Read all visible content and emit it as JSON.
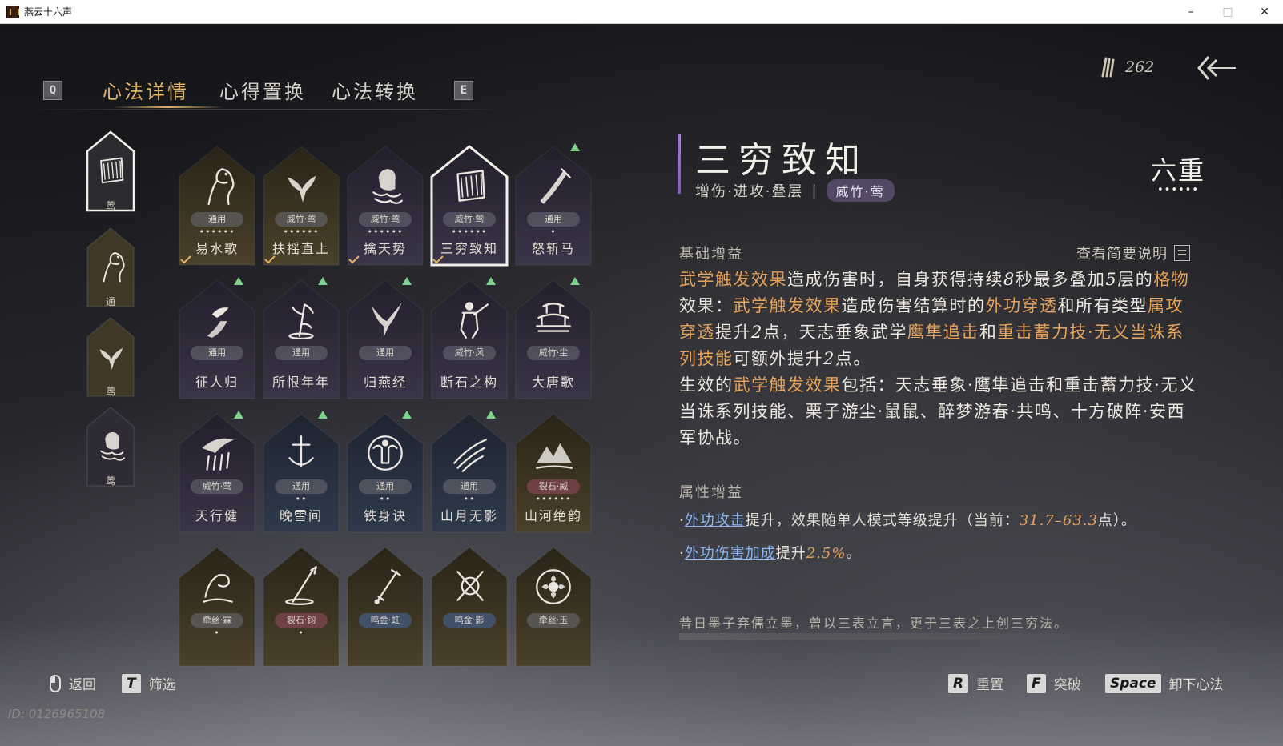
{
  "window": {
    "title": "燕云十六声",
    "controls": [
      "–",
      "□",
      "✕"
    ]
  },
  "tabs": {
    "left_key": "Q",
    "right_key": "E",
    "items": [
      {
        "label": "心法详情",
        "active": true
      },
      {
        "label": "心得置换",
        "active": false
      },
      {
        "label": "心法转换",
        "active": false
      }
    ]
  },
  "currency": {
    "icon": "feather-quill-icon",
    "value": "262"
  },
  "left_slots": [
    {
      "tag": "莺",
      "icon": "scroll-icon",
      "selected": true
    },
    {
      "tag": "通",
      "icon": "horse-icon",
      "selected": false
    },
    {
      "tag": "莺",
      "icon": "eagle-icon",
      "selected": false
    },
    {
      "tag": "莺",
      "icon": "chained-fist-icon",
      "selected": false
    }
  ],
  "grid": [
    {
      "name": "易水歌",
      "tag": "通用",
      "pips": "••••••",
      "icon": "horse-icon",
      "tone": "gold",
      "equipped": true,
      "upgrade": false
    },
    {
      "name": "扶摇直上",
      "tag": "威竹·莺",
      "pips": "••••••",
      "icon": "eagle-icon",
      "tone": "gold",
      "equipped": true,
      "upgrade": false
    },
    {
      "name": "擒天势",
      "tag": "威竹·莺",
      "pips": "••••••",
      "icon": "chained-fist-icon",
      "tone": "purple",
      "equipped": true,
      "upgrade": false
    },
    {
      "name": "三穷致知",
      "tag": "威竹·莺",
      "pips": "••••••",
      "icon": "scroll-icon",
      "tone": "purple",
      "equipped": true,
      "selected": true,
      "upgrade": false
    },
    {
      "name": "怒斩马",
      "tag": "通用",
      "pips": "•",
      "icon": "blade-icon",
      "tone": "purple",
      "equipped": false,
      "upgrade": true
    },
    {
      "name": "征人归",
      "tag": "通用",
      "pips": "",
      "icon": "crow-hand-icon",
      "tone": "purple",
      "equipped": false,
      "upgrade": true
    },
    {
      "name": "所恨年年",
      "tag": "通用",
      "pips": "",
      "icon": "bamboo-icon",
      "tone": "purple",
      "equipped": false,
      "upgrade": true
    },
    {
      "name": "归燕经",
      "tag": "通用",
      "pips": "",
      "icon": "swallow-icon",
      "tone": "purple",
      "equipped": false,
      "upgrade": true
    },
    {
      "name": "断石之构",
      "tag": "威竹·风",
      "pips": "",
      "icon": "warrior-icon",
      "tone": "purple",
      "equipped": false,
      "upgrade": true
    },
    {
      "name": "大唐歌",
      "tag": "威竹·尘",
      "pips": "",
      "icon": "palace-icon",
      "tone": "purple",
      "equipped": false,
      "upgrade": true
    },
    {
      "name": "天行健",
      "tag": "威竹·莺",
      "pips": "",
      "icon": "storm-icon",
      "tone": "purple",
      "equipped": false,
      "upgrade": true
    },
    {
      "name": "晚雪间",
      "tag": "通用",
      "pips": "••",
      "icon": "anchor-icon",
      "tone": "blue",
      "equipped": false,
      "upgrade": true
    },
    {
      "name": "铁身诀",
      "tag": "通用",
      "pips": "••",
      "icon": "strongman-icon",
      "tone": "blue",
      "equipped": false,
      "upgrade": true
    },
    {
      "name": "山月无影",
      "tag": "通用",
      "pips": "••",
      "icon": "slash-icon",
      "tone": "blue",
      "equipped": false,
      "upgrade": true
    },
    {
      "name": "山河绝韵",
      "tag": "裂石·威",
      "pips": "••••••",
      "icon": "mountain-icon",
      "tone": "gold",
      "equipped": false,
      "upgrade": false
    },
    {
      "name": "",
      "tag": "牵丝·霖",
      "pips": "•",
      "icon": "wave-icon",
      "tone": "gold",
      "equipped": false,
      "upgrade": false
    },
    {
      "name": "",
      "tag": "裂石·钧",
      "pips": "•",
      "icon": "spear-icon",
      "tone": "gold",
      "equipped": false,
      "upgrade": false
    },
    {
      "name": "",
      "tag": "鸣金·虹",
      "pips": "",
      "icon": "sword-icon",
      "tone": "gold",
      "equipped": false,
      "upgrade": false
    },
    {
      "name": "",
      "tag": "鸣金·影",
      "pips": "",
      "icon": "crossed-swords-icon",
      "tone": "gold",
      "equipped": false,
      "upgrade": false
    },
    {
      "name": "",
      "tag": "牵丝·玉",
      "pips": "",
      "icon": "flower-icon",
      "tone": "gold",
      "equipped": false,
      "upgrade": false
    }
  ],
  "detail": {
    "title": "三穷致知",
    "subtitle": "增伤·进攻·叠层",
    "school_chip": "威竹·莺",
    "rank": "六重",
    "rank_pips": "••••••",
    "base_heading": "基础增益",
    "desc_link": "查看简要说明",
    "effect": [
      {
        "t": "武学触发效果",
        "c": "hl"
      },
      {
        "t": "造成伤害时，自身获得持续"
      },
      {
        "t": "8",
        "c": "num"
      },
      {
        "t": "秒最多叠加"
      },
      {
        "t": "5",
        "c": "num"
      },
      {
        "t": "层的"
      },
      {
        "t": "格物",
        "c": "hl"
      },
      {
        "t": "效果："
      },
      {
        "t": "武学触发效果",
        "c": "hl"
      },
      {
        "t": "造成伤害结算时的"
      },
      {
        "t": "外功穿透",
        "c": "hl"
      },
      {
        "t": "和所有类型"
      },
      {
        "t": "属攻穿透",
        "c": "hl"
      },
      {
        "t": "提升"
      },
      {
        "t": "2",
        "c": "num"
      },
      {
        "t": "点，天志垂象武学"
      },
      {
        "t": "鹰隼追击",
        "c": "hl"
      },
      {
        "t": "和"
      },
      {
        "t": "重击蓄力技·无义当诛系列技能",
        "c": "hl"
      },
      {
        "t": "可额外提升"
      },
      {
        "t": "2",
        "c": "num"
      },
      {
        "t": "点。"
      },
      {
        "t": "\n"
      },
      {
        "t": "生效的"
      },
      {
        "t": "武学触发效果",
        "c": "hl"
      },
      {
        "t": "包括：天志垂象·鹰隼追击和重击蓄力技·无义当诛系列技能、栗子游尘·鼠鼠、醉梦游春·共鸣、十方破阵·安西军协战。"
      }
    ],
    "attr_heading": "属性增益",
    "attr1": {
      "prefix": "·",
      "link": "外功攻击",
      "mid": "提升，效果随单人模式等级提升（当前：",
      "value": "31.7–63.3",
      "suffix": "点）。"
    },
    "attr2": {
      "prefix": "·",
      "link": "外功伤害加成",
      "mid": "提升",
      "value": "2.5%",
      "suffix": "。"
    },
    "lore": "昔日墨子弃儒立墨，曾以三表立言，更于三表之上创三穷法。"
  },
  "bottom": {
    "back_label": "返回",
    "filter_key": "T",
    "filter_label": "筛选",
    "reset_key": "R",
    "reset_label": "重置",
    "break_key": "F",
    "break_label": "突破",
    "unequip_key": "Space",
    "unequip_label": "卸下心法"
  },
  "id_text": "ID: 0126965108",
  "colors": {
    "accent_gold": "#e3b466",
    "highlight_orange": "#e8a35a",
    "link_blue": "#8fb6f0",
    "upgrade_green": "#7fd28c",
    "title_bar_purple": "#a680e0"
  }
}
